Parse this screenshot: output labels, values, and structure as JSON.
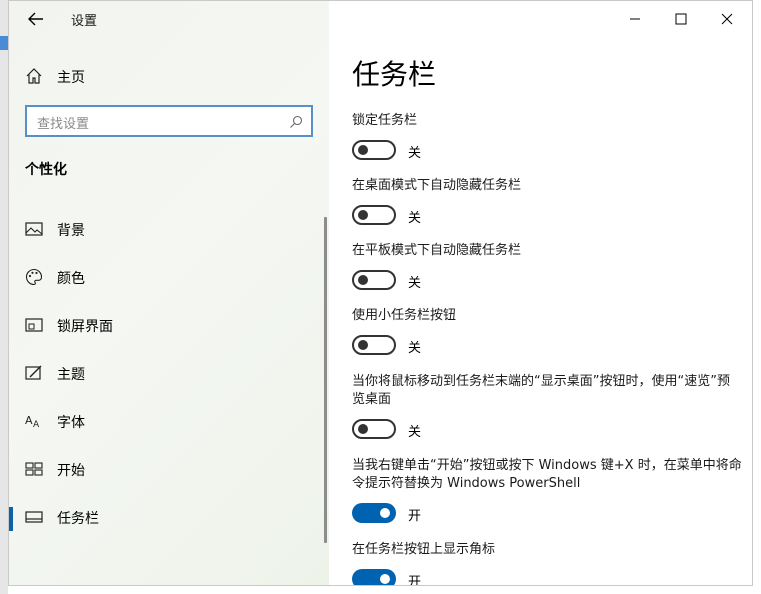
{
  "window": {
    "title": "设置"
  },
  "controls": {
    "minimize": "minimize-icon",
    "maximize": "maximize-icon",
    "close": "close-icon"
  },
  "sidebar": {
    "home_label": "主页",
    "search_placeholder": "查找设置",
    "section_title": "个性化",
    "items": [
      {
        "label": "背景",
        "icon": "picture-icon"
      },
      {
        "label": "颜色",
        "icon": "palette-icon"
      },
      {
        "label": "锁屏界面",
        "icon": "lock-screen-icon"
      },
      {
        "label": "主题",
        "icon": "theme-icon"
      },
      {
        "label": "字体",
        "icon": "font-icon"
      },
      {
        "label": "开始",
        "icon": "start-icon"
      },
      {
        "label": "任务栏",
        "icon": "taskbar-icon",
        "active": true
      }
    ]
  },
  "main": {
    "title": "任务栏",
    "settings": [
      {
        "label": "锁定任务栏",
        "on": false,
        "state": "关"
      },
      {
        "label": "在桌面模式下自动隐藏任务栏",
        "on": false,
        "state": "关"
      },
      {
        "label": "在平板模式下自动隐藏任务栏",
        "on": false,
        "state": "关"
      },
      {
        "label": "使用小任务栏按钮",
        "on": false,
        "state": "关"
      },
      {
        "label": "当你将鼠标移动到任务栏末端的“显示桌面”按钮时，使用“速览”预览桌面",
        "on": false,
        "state": "关"
      },
      {
        "label": "当我右键单击“开始”按钮或按下 Windows 键+X 时，在菜单中将命令提示符替换为 Windows PowerShell",
        "on": true,
        "state": "开"
      },
      {
        "label": "在任务栏按钮上显示角标",
        "on": true,
        "state": "开"
      }
    ]
  },
  "colors": {
    "accent": "#0063b1",
    "search_border": "#5590c8"
  }
}
